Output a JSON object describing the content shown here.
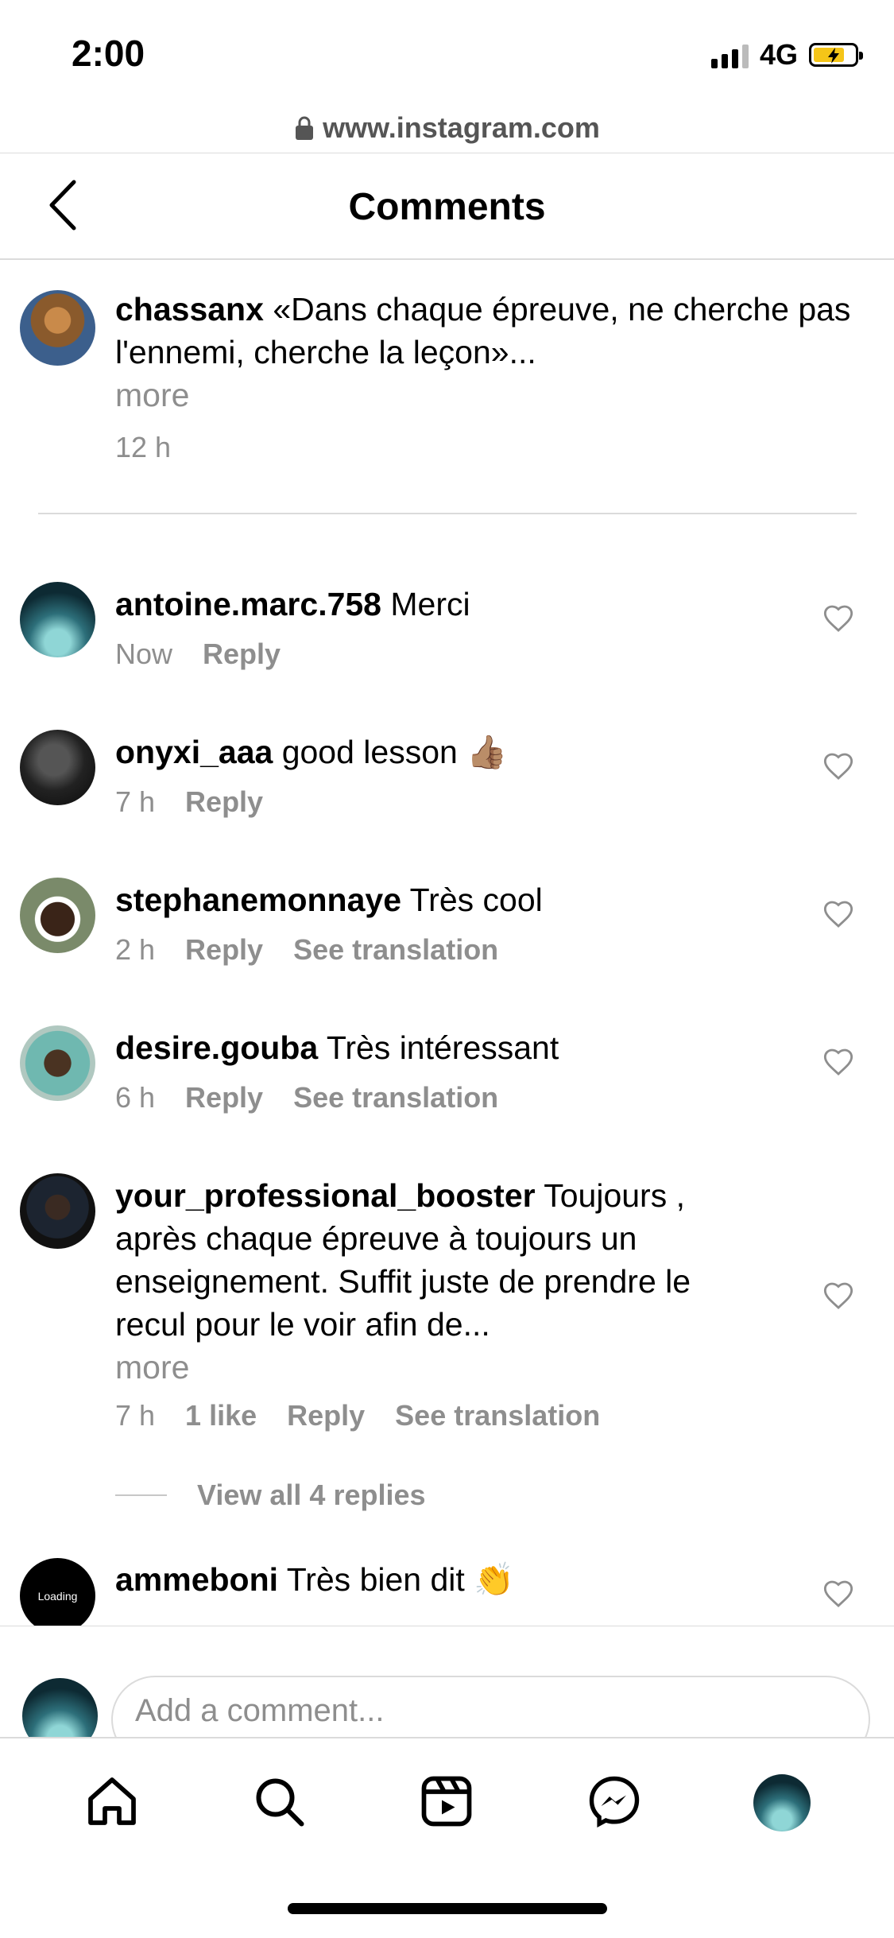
{
  "status": {
    "time": "2:00",
    "network": "4G"
  },
  "browser": {
    "url": "www.instagram.com"
  },
  "header": {
    "title": "Comments"
  },
  "caption": {
    "username": "chassanx",
    "text": "«Dans chaque épreuve, ne cherche pas l'ennemi, cherche la leçon»...",
    "more": "more",
    "time": "12 h"
  },
  "comments": [
    {
      "username": "antoine.marc.758",
      "text": "Merci",
      "time": "Now",
      "reply": "Reply"
    },
    {
      "username": "onyxi_aaa",
      "text": "good lesson 👍🏽",
      "time": "7 h",
      "reply": "Reply"
    },
    {
      "username": "stephanemonnaye",
      "text": "Très cool",
      "time": "2 h",
      "reply": "Reply",
      "translate": "See translation"
    },
    {
      "username": "desire.gouba",
      "text": "Très intéressant",
      "time": "6 h",
      "reply": "Reply",
      "translate": "See translation"
    },
    {
      "username": "your_professional_booster",
      "text": "Toujours , après chaque épreuve à toujours un enseignement. Suffit juste de prendre le recul pour le voir afin de...",
      "more": "more",
      "time": "7 h",
      "likes": "1 like",
      "reply": "Reply",
      "translate": "See translation"
    },
    {
      "username": "ammeboni",
      "text": "Très bien dit 👏",
      "avatar_text": "Loading"
    }
  ],
  "view_replies": "View all 4 replies",
  "comment_input": {
    "placeholder": "Add a comment..."
  },
  "nav": [
    "home-icon",
    "search-icon",
    "reels-icon",
    "messenger-icon",
    "profile-avatar"
  ],
  "colors": {
    "muted": "#8e8e8e",
    "divider": "#dbdbdb",
    "battery": "#f5c518"
  }
}
